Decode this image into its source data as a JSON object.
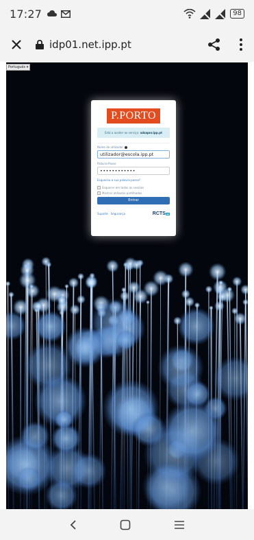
{
  "status_bar": {
    "time": "17:27",
    "battery": "98"
  },
  "address_bar": {
    "url": "idp01.net.ipp.pt"
  },
  "page": {
    "language_select": "Português ▾",
    "logo_text": "P.PORTO",
    "notice_prefix": "Está a aceder ao serviço: ",
    "notice_service": "sdsapnr.ipp.pt",
    "username_label": "Nome de utilizador",
    "username_value": "utilizador@escola.ipp.pt",
    "password_label": "Palavra-Passe",
    "password_value": "••••••••••••",
    "forgot_link": "Esqueceu-a sua palavra-passe?",
    "check_forget": "Esquecer em todas as sessões",
    "check_show": "Mostrar atributos partilhados",
    "enter_button": "Entrar",
    "footer_support": "Suporte",
    "footer_security": "Segurança",
    "rcts_logo": "RCTS",
    "rcts_badge": "aai"
  },
  "colors": {
    "accent": "#2f6db5",
    "brand": "#e34c1f",
    "background": "#03060c"
  }
}
